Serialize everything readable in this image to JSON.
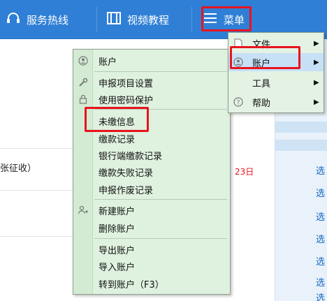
{
  "toolbar": {
    "hotline_label": "服务热线",
    "video_label": "视频教程",
    "menu_label": "菜单"
  },
  "background": {
    "left_text": "张征收）",
    "date_text": "23日",
    "right_links": [
      "选",
      "选",
      "选",
      "选",
      "选",
      "选",
      "选"
    ]
  },
  "main_menu": {
    "items": [
      {
        "label": "文件",
        "icon": "document-icon",
        "has_submenu": true
      },
      {
        "label": "账户",
        "icon": "user-icon",
        "has_submenu": true,
        "active": true
      },
      {
        "label": "工具",
        "icon": "",
        "has_submenu": true
      },
      {
        "label": "帮助",
        "icon": "help-icon",
        "has_submenu": true
      }
    ]
  },
  "account_menu": {
    "items": [
      {
        "label": "账户",
        "icon": "user-icon"
      },
      {
        "label": "申报项目设置",
        "icon": "wrench-icon"
      },
      {
        "label": "使用密码保护",
        "icon": "lock-icon"
      },
      {
        "label": "未缴信息",
        "icon": "",
        "highlighted": true
      },
      {
        "label": "缴款记录",
        "icon": ""
      },
      {
        "label": "银行端缴款记录",
        "icon": ""
      },
      {
        "label": "缴款失败记录",
        "icon": ""
      },
      {
        "label": "申报作废记录",
        "icon": ""
      },
      {
        "label": "新建账户",
        "icon": "add-user-icon"
      },
      {
        "label": "删除账户",
        "icon": ""
      },
      {
        "label": "导出账户",
        "icon": ""
      },
      {
        "label": "导入账户",
        "icon": ""
      },
      {
        "label": "转到账户（F3）",
        "icon": ""
      }
    ]
  },
  "colors": {
    "toolbar_bg": "#2f7fd6",
    "menu_bg": "#dff1df",
    "highlight_border": "#e8141e",
    "link": "#1566c0"
  }
}
